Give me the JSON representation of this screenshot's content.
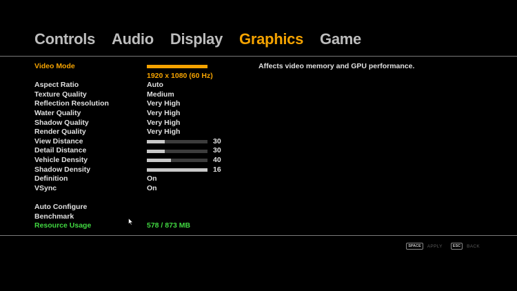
{
  "tabs": [
    {
      "label": "Controls",
      "active": false
    },
    {
      "label": "Audio",
      "active": false
    },
    {
      "label": "Display",
      "active": false
    },
    {
      "label": "Graphics",
      "active": true
    },
    {
      "label": "Game",
      "active": false
    }
  ],
  "settings": {
    "video_mode": {
      "label": "Video Mode",
      "value": "1920 x 1080 (60 Hz)"
    },
    "aspect_ratio": {
      "label": "Aspect Ratio",
      "value": "Auto"
    },
    "texture_quality": {
      "label": "Texture Quality",
      "value": "Medium"
    },
    "reflection_resolution": {
      "label": "Reflection Resolution",
      "value": "Very High"
    },
    "water_quality": {
      "label": "Water Quality",
      "value": "Very High"
    },
    "shadow_quality": {
      "label": "Shadow Quality",
      "value": "Very High"
    },
    "render_quality": {
      "label": "Render Quality",
      "value": "Very High"
    },
    "view_distance": {
      "label": "View Distance",
      "value": "30",
      "level": 0.3
    },
    "detail_distance": {
      "label": "Detail Distance",
      "value": "30",
      "level": 0.3
    },
    "vehicle_density": {
      "label": "Vehicle Density",
      "value": "40",
      "level": 0.4
    },
    "shadow_density": {
      "label": "Shadow Density",
      "value": "16",
      "level": 1.0
    },
    "definition": {
      "label": "Definition",
      "value": "On"
    },
    "vsync": {
      "label": "VSync",
      "value": "On"
    }
  },
  "actions": {
    "auto_configure": "Auto Configure",
    "benchmark": "Benchmark"
  },
  "resource_usage": {
    "label": "Resource Usage",
    "value": "578 / 873 MB"
  },
  "description": "Affects video memory and GPU performance.",
  "footer": {
    "apply_key": "SPACE",
    "apply_label": "APPLY",
    "back_key": "ESC",
    "back_label": "BACK"
  },
  "colors": {
    "accent": "#f5a300",
    "highlight": "#41d841",
    "text": "#e0e0e0"
  },
  "icons": {
    "cursor": "mouse-cursor-icon"
  }
}
